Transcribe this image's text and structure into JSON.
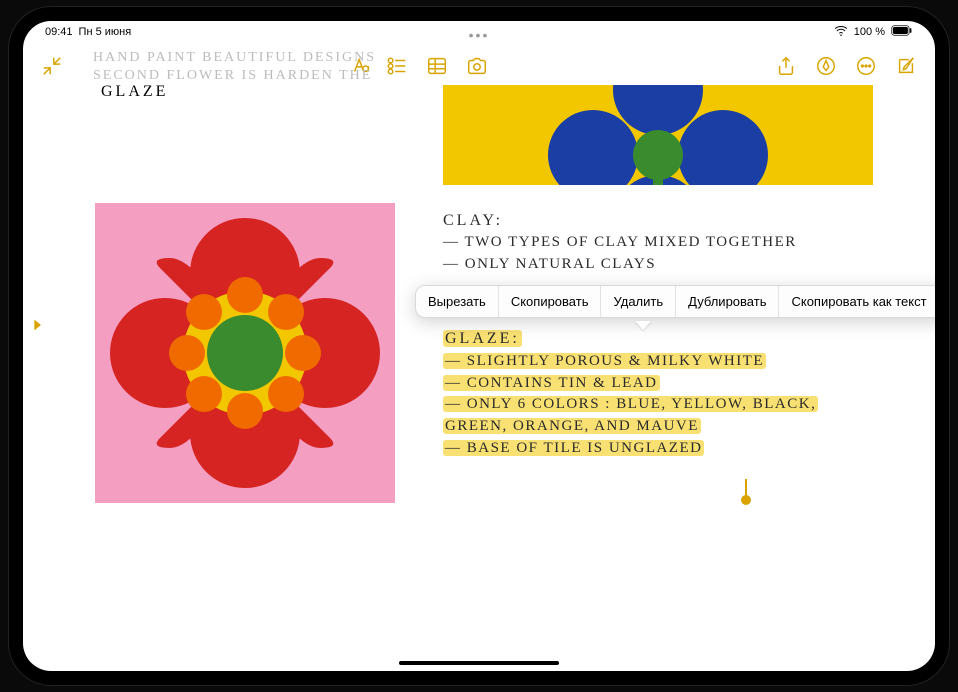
{
  "status": {
    "time": "09:41",
    "date": "Пн 5 июня",
    "battery": "100 %"
  },
  "toolbar": {
    "icons": {
      "collapse": "collapse-icon",
      "format": "format-text-icon",
      "checklist": "checklist-icon",
      "table": "table-icon",
      "camera": "camera-icon",
      "share": "share-icon",
      "markup": "markup-icon",
      "more": "more-icon",
      "compose": "compose-icon"
    }
  },
  "faded": {
    "line1": "HAND PAINT BEAUTIFUL DESIGNS",
    "line2": "SECOND FLOWER IS HARDEN THE"
  },
  "glaze_word": "GLAZE",
  "handwriting": {
    "clay": {
      "title": "CLAY:",
      "line1": "— TWO TYPES OF CLAY MIXED TOGETHER",
      "line2": "— ONLY NATURAL CLAYS"
    },
    "glaze": {
      "title": "GLAZE:",
      "line1": "— SLIGHTLY POROUS & MILKY WHITE",
      "line2": "— CONTAINS TIN & LEAD",
      "line3": "— ONLY 6 COLORS : BLUE, YELLOW, BLACK,",
      "line3b": "   GREEN, ORANGE, AND MAUVE",
      "line4": "— BASE OF TILE IS UNGLAZED"
    }
  },
  "context_menu": {
    "items": [
      "Вырезать",
      "Скопировать",
      "Удалить",
      "Дублировать",
      "Скопировать как текст"
    ]
  }
}
